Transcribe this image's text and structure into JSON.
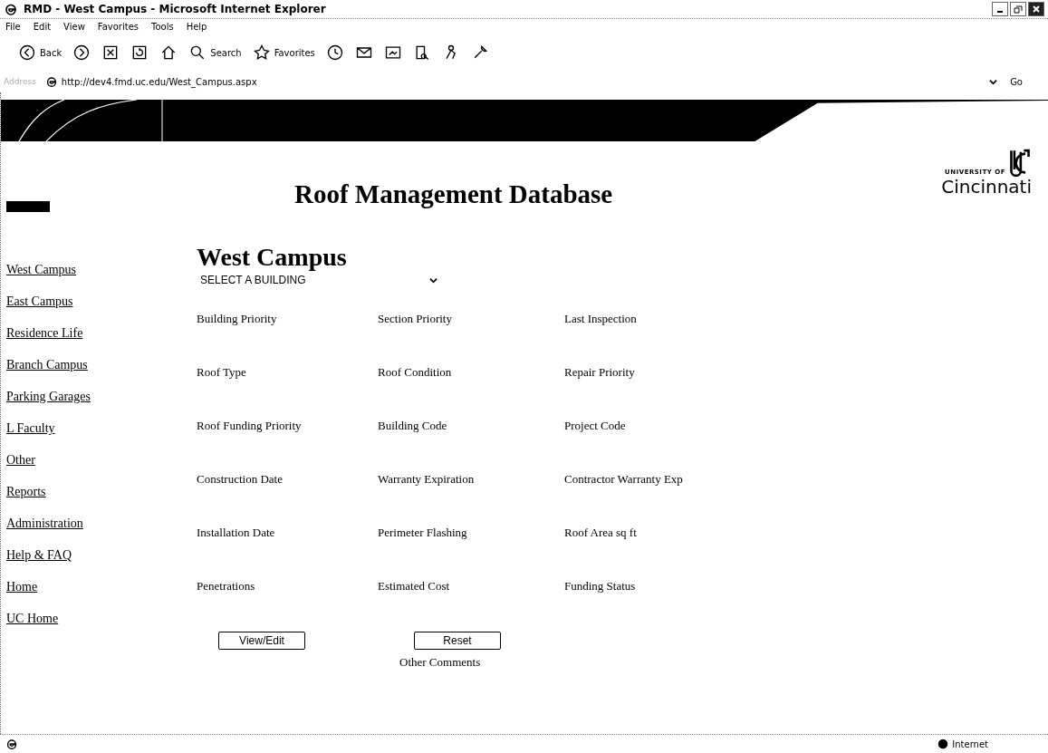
{
  "window": {
    "title": "RMD - West Campus - Microsoft Internet Explorer"
  },
  "menu": [
    {
      "label": "File"
    },
    {
      "label": "Edit"
    },
    {
      "label": "View"
    },
    {
      "label": "Favorites"
    },
    {
      "label": "Tools"
    },
    {
      "label": "Help"
    }
  ],
  "toolbar": [
    {
      "kind": "back",
      "label": "Back"
    },
    {
      "kind": "forward"
    },
    {
      "kind": "stop"
    },
    {
      "kind": "refresh"
    },
    {
      "kind": "home"
    },
    {
      "kind": "search",
      "label": "Search"
    },
    {
      "kind": "favorites",
      "label": "Favorites"
    },
    {
      "kind": "history"
    },
    {
      "kind": "mail"
    },
    {
      "kind": "edit"
    },
    {
      "kind": "research"
    },
    {
      "kind": "messenger"
    },
    {
      "kind": "tools"
    }
  ],
  "address": {
    "label": "Address",
    "value": "http://dev4.fmd.uc.edu/West_Campus.aspx",
    "go": "Go"
  },
  "header": {
    "title": "Roof Management Database",
    "logo_small": "UNIVERSITY OF",
    "logo_name": "Cincinnati"
  },
  "sidebar": {
    "items": [
      {
        "label": "West Campus"
      },
      {
        "label": "East Campus"
      },
      {
        "label": "Residence Life"
      },
      {
        "label": "Branch Campus"
      },
      {
        "label": "Parking Garages"
      },
      {
        "label": "L Faculty"
      },
      {
        "label": "Other"
      },
      {
        "label": "Reports"
      },
      {
        "label": "Administration"
      },
      {
        "label": "Help & FAQ"
      },
      {
        "label": "Home"
      },
      {
        "label": "UC Home"
      }
    ]
  },
  "content": {
    "heading": "West Campus",
    "building_select": {
      "value": "SELECT A BUILDING"
    },
    "fields": [
      [
        "Building Priority",
        "Section Priority",
        "Last Inspection"
      ],
      [
        "Roof Type",
        "Roof Condition",
        "Repair Priority"
      ],
      [
        "Roof Funding Priority",
        "Building Code",
        "Project Code"
      ],
      [
        "Construction Date",
        "Warranty Expiration",
        "Contractor Warranty Exp"
      ],
      [
        "Installation Date",
        "Perimeter Flashing",
        "Roof Area sq ft"
      ],
      [
        "Penetrations",
        "Estimated Cost",
        "Funding Status"
      ]
    ],
    "buttons": [
      "View/Edit",
      "Reset"
    ],
    "comments_label": "Other Comments"
  },
  "status_bar": {
    "zone": "Internet"
  }
}
